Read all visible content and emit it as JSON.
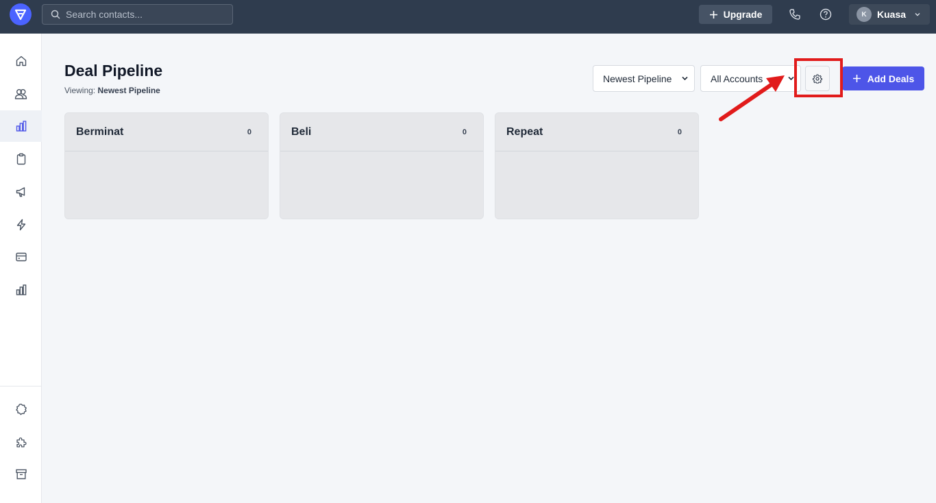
{
  "topbar": {
    "search_placeholder": "Search contacts...",
    "upgrade_label": "Upgrade",
    "user_initial": "K",
    "user_name": "Kuasa"
  },
  "sidebar": {
    "items": [
      {
        "icon": "home-icon"
      },
      {
        "icon": "contacts-icon"
      },
      {
        "icon": "pipeline-icon",
        "active": true
      },
      {
        "icon": "clipboard-icon"
      },
      {
        "icon": "megaphone-icon"
      },
      {
        "icon": "lightning-icon"
      },
      {
        "icon": "billing-icon"
      },
      {
        "icon": "reports-icon"
      }
    ],
    "bottom_items": [
      {
        "icon": "settings-badge-icon"
      },
      {
        "icon": "puzzle-icon"
      },
      {
        "icon": "archive-icon"
      }
    ]
  },
  "header": {
    "title": "Deal Pipeline",
    "viewing_prefix": "Viewing:",
    "viewing_value": "Newest Pipeline"
  },
  "toolbar": {
    "pipeline_select": "Newest Pipeline",
    "accounts_select": "All Accounts",
    "add_label": "Add Deals"
  },
  "columns": [
    {
      "title": "Berminat",
      "count": "0"
    },
    {
      "title": "Beli",
      "count": "0"
    },
    {
      "title": "Repeat",
      "count": "0"
    }
  ],
  "colors": {
    "accent": "#4d55e8",
    "topbar": "#2f3c4e",
    "highlight": "#e11b1b"
  }
}
